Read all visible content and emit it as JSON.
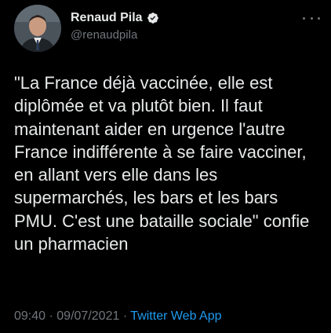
{
  "author": {
    "name": "Renaud Pila",
    "handle": "@renaudpila",
    "verified": true,
    "avatar_icon": "avatar-icon"
  },
  "tweet": {
    "text": "\"La France déjà vaccinée, elle est diplômée et va plutôt bien. Il faut maintenant aider en urgence l'autre France indifférente à se faire vacciner, en allant vers elle dans les supermarchés, les bars et les bars PMU. C'est une bataille sociale\" confie un pharmacien",
    "time": "09:40",
    "separator": "·",
    "date": "09/07/2021",
    "source": "Twitter Web App"
  },
  "colors": {
    "background": "#000000",
    "primary_text": "#e7e9ea",
    "secondary_text": "#71767b",
    "accent": "#1d9bf0"
  },
  "icons": {
    "verified": "verified-badge-icon",
    "more": "more-options-icon"
  }
}
